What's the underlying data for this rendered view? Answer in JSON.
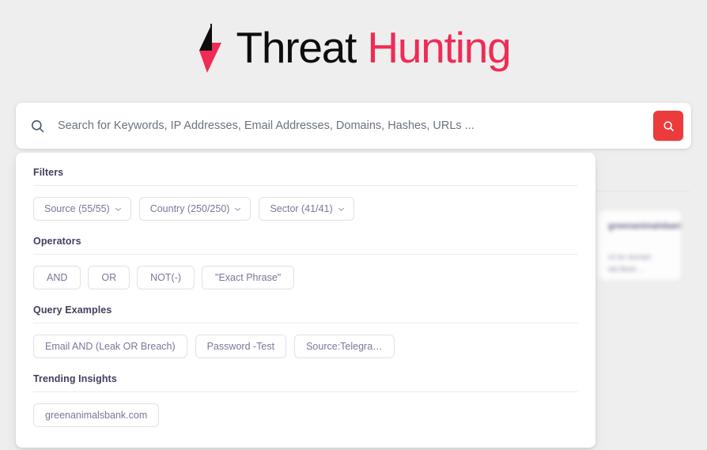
{
  "brand": {
    "icon": "lightning-bolt-icon",
    "title_part_1": "Threat",
    "title_part_2": "Hunting",
    "color_dark": "#0d0d0f",
    "color_accent": "#ef2b56"
  },
  "search": {
    "icon": "search-icon",
    "placeholder": "Search for Keywords, IP Addresses, Email Addresses, Domains, Hashes, URLs ...",
    "value": "",
    "submit_icon": "search-icon",
    "submit_color": "#eb3b3b"
  },
  "panel": {
    "sections": [
      {
        "title": "Filters",
        "chips": [
          {
            "label": "Source (55/55)",
            "has_chevron": true
          },
          {
            "label": "Country (250/250)",
            "has_chevron": true
          },
          {
            "label": "Sector (41/41)",
            "has_chevron": true
          }
        ]
      },
      {
        "title": "Operators",
        "chips": [
          {
            "label": "AND",
            "has_chevron": false
          },
          {
            "label": "OR",
            "has_chevron": false
          },
          {
            "label": "NOT(-)",
            "has_chevron": false
          },
          {
            "label": "\"Exact Phrase\"",
            "has_chevron": false
          }
        ]
      },
      {
        "title": "Query Examples",
        "chips": [
          {
            "label": "Email AND (Leak OR Breach)",
            "has_chevron": false
          },
          {
            "label": "Password -Test",
            "has_chevron": false
          },
          {
            "label": "Source:Telegra…",
            "has_chevron": false
          }
        ]
      },
      {
        "title": "Trending Insights",
        "chips": [
          {
            "label": "greenanimalsbank.com",
            "has_chevron": false
          }
        ]
      }
    ]
  },
  "background": {
    "card_title": "greenanimalsbank",
    "card_line_1": "ch for domain",
    "card_line_2": "ata Base ..."
  }
}
